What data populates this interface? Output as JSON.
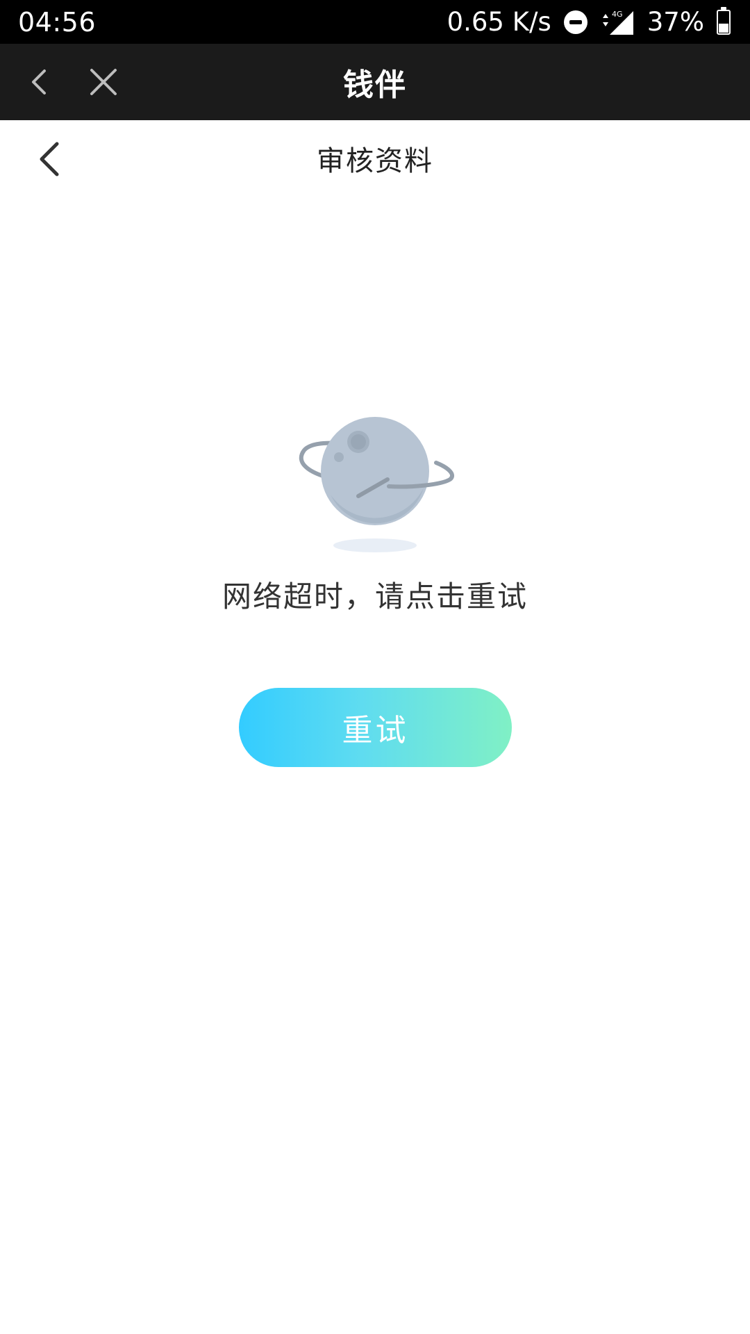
{
  "status_bar": {
    "time": "04:56",
    "net_speed": "0.65 K/s",
    "network_type": "4G",
    "battery": "37%"
  },
  "app_bar": {
    "title": "钱伴",
    "back_icon": "chevron-left-icon",
    "close_icon": "close-icon"
  },
  "page_header": {
    "title": "审核资料",
    "back_icon": "chevron-left-icon"
  },
  "error_state": {
    "illustration": "planet-icon",
    "message": "网络超时，请点击重试",
    "retry_label": "重试"
  },
  "colors": {
    "status_bar_bg": "#000000",
    "app_bar_bg": "#1b1b1b",
    "button_gradient_start": "#33ccff",
    "button_gradient_end": "#80f0c5",
    "planet": "#b7c4d3"
  }
}
